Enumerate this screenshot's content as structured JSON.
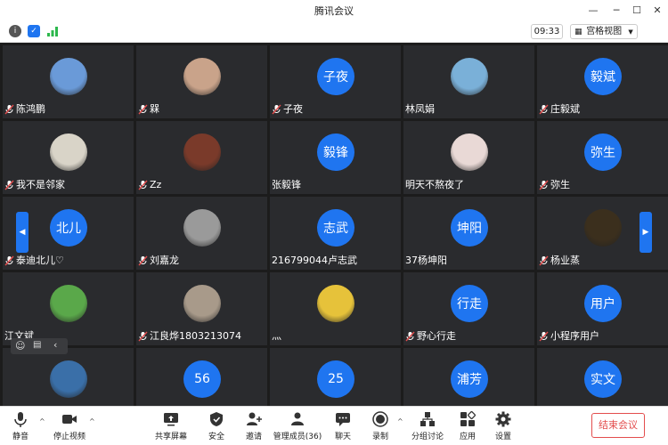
{
  "window": {
    "title": "腾讯会议"
  },
  "infobar": {
    "clock": "09:33",
    "view_label": "宫格视图"
  },
  "tiles": [
    {
      "name": "陈鸿鹏",
      "mic": true,
      "avatar": "photo",
      "color": "#6a9ad8"
    },
    {
      "name": "槑",
      "mic": true,
      "avatar": "photo",
      "color": "#c9a38a"
    },
    {
      "name": "子夜",
      "mic": true,
      "avatar": "子夜"
    },
    {
      "name": "林凤娟",
      "mic": false,
      "avatar": "photo",
      "color": "#7ab0d8"
    },
    {
      "name": "庄毅斌",
      "mic": true,
      "avatar": "毅斌"
    },
    {
      "name": "我不是邻家",
      "mic": true,
      "avatar": "photo",
      "color": "#d9d4c8"
    },
    {
      "name": "Zz",
      "mic": true,
      "avatar": "photo",
      "color": "#7a3a2a"
    },
    {
      "name": "张毅锋",
      "mic": false,
      "avatar": "毅锋"
    },
    {
      "name": "明天不熬夜了",
      "mic": false,
      "avatar": "photo",
      "color": "#e9d9d6"
    },
    {
      "name": "弥生",
      "mic": true,
      "avatar": "弥生"
    },
    {
      "name": "泰迪北儿♡",
      "mic": true,
      "avatar": "北儿"
    },
    {
      "name": "刘嘉龙",
      "mic": true,
      "avatar": "photo",
      "color": "#9a9a9a"
    },
    {
      "name": "216799044卢志武",
      "mic": false,
      "avatar": "志武"
    },
    {
      "name": "37杨坤阳",
      "mic": false,
      "avatar": "坤阳"
    },
    {
      "name": "杨业蒸",
      "mic": true,
      "avatar": "photo",
      "color": "#3b2f1d"
    },
    {
      "name": "江文斌",
      "mic": false,
      "avatar": "photo",
      "color": "#5aa84a"
    },
    {
      "name": "江良烨1803213074",
      "mic": true,
      "avatar": "photo",
      "color": "#a89a8a"
    },
    {
      "name": "灬",
      "mic": false,
      "avatar": "photo",
      "color": "#e6c23a"
    },
    {
      "name": "野心行走",
      "mic": true,
      "avatar": "行走"
    },
    {
      "name": "小程序用户",
      "mic": true,
      "avatar": "用户"
    },
    {
      "name": "",
      "mic": false,
      "avatar": "photo",
      "color": "#3a6fa8"
    },
    {
      "name": "",
      "mic": false,
      "avatar": "56"
    },
    {
      "name": "",
      "mic": false,
      "avatar": "25"
    },
    {
      "name": "",
      "mic": false,
      "avatar": "浦芳"
    },
    {
      "name": "",
      "mic": false,
      "avatar": "实文"
    }
  ],
  "toolbar": {
    "mute": "静音",
    "stop_video": "停止视频",
    "share": "共享屏幕",
    "security": "安全",
    "invite": "邀请",
    "members": "管理成员(36)",
    "chat": "聊天",
    "record": "录制",
    "breakout": "分组讨论",
    "apps": "应用",
    "settings": "设置",
    "end": "结束会议"
  },
  "colors": {
    "accent": "#1f75f0",
    "end": "#e34d4d",
    "tile": "#2a2b2e"
  }
}
